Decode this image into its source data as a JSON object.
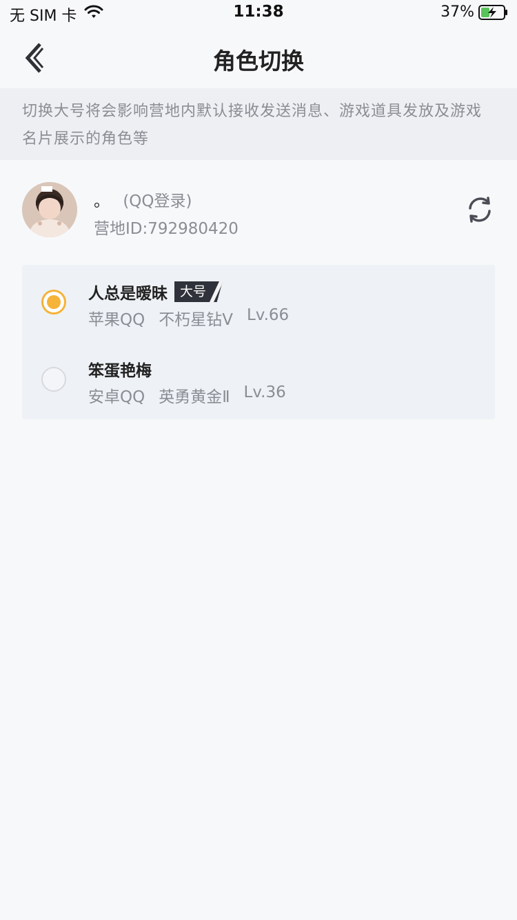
{
  "status_bar": {
    "carrier": "无 SIM 卡",
    "time": "11:38",
    "battery": "37%"
  },
  "nav": {
    "title": "角色切换"
  },
  "notice": {
    "text": "切换大号将会影响营地内默认接收发送消息、游戏道具发放及游戏名片展示的角色等"
  },
  "account": {
    "name": "。",
    "login": "(QQ登录)",
    "camp_id": "营地ID:792980420"
  },
  "roles": [
    {
      "name": "人总是暧昧",
      "badge": "大号",
      "platform": "苹果QQ",
      "rank": "不朽星钻Ⅴ",
      "level": "Lv.66",
      "selected": true
    },
    {
      "name": "笨蛋艳梅",
      "platform": "安卓QQ",
      "rank": "英勇黄金Ⅱ",
      "level": "Lv.36",
      "selected": false
    }
  ],
  "colors": {
    "accent": "#f5b338",
    "background": "#f7f8fa",
    "notice_bg": "#eeeff2",
    "list_bg": "#eef1f5",
    "muted_text": "#8a8d94"
  }
}
